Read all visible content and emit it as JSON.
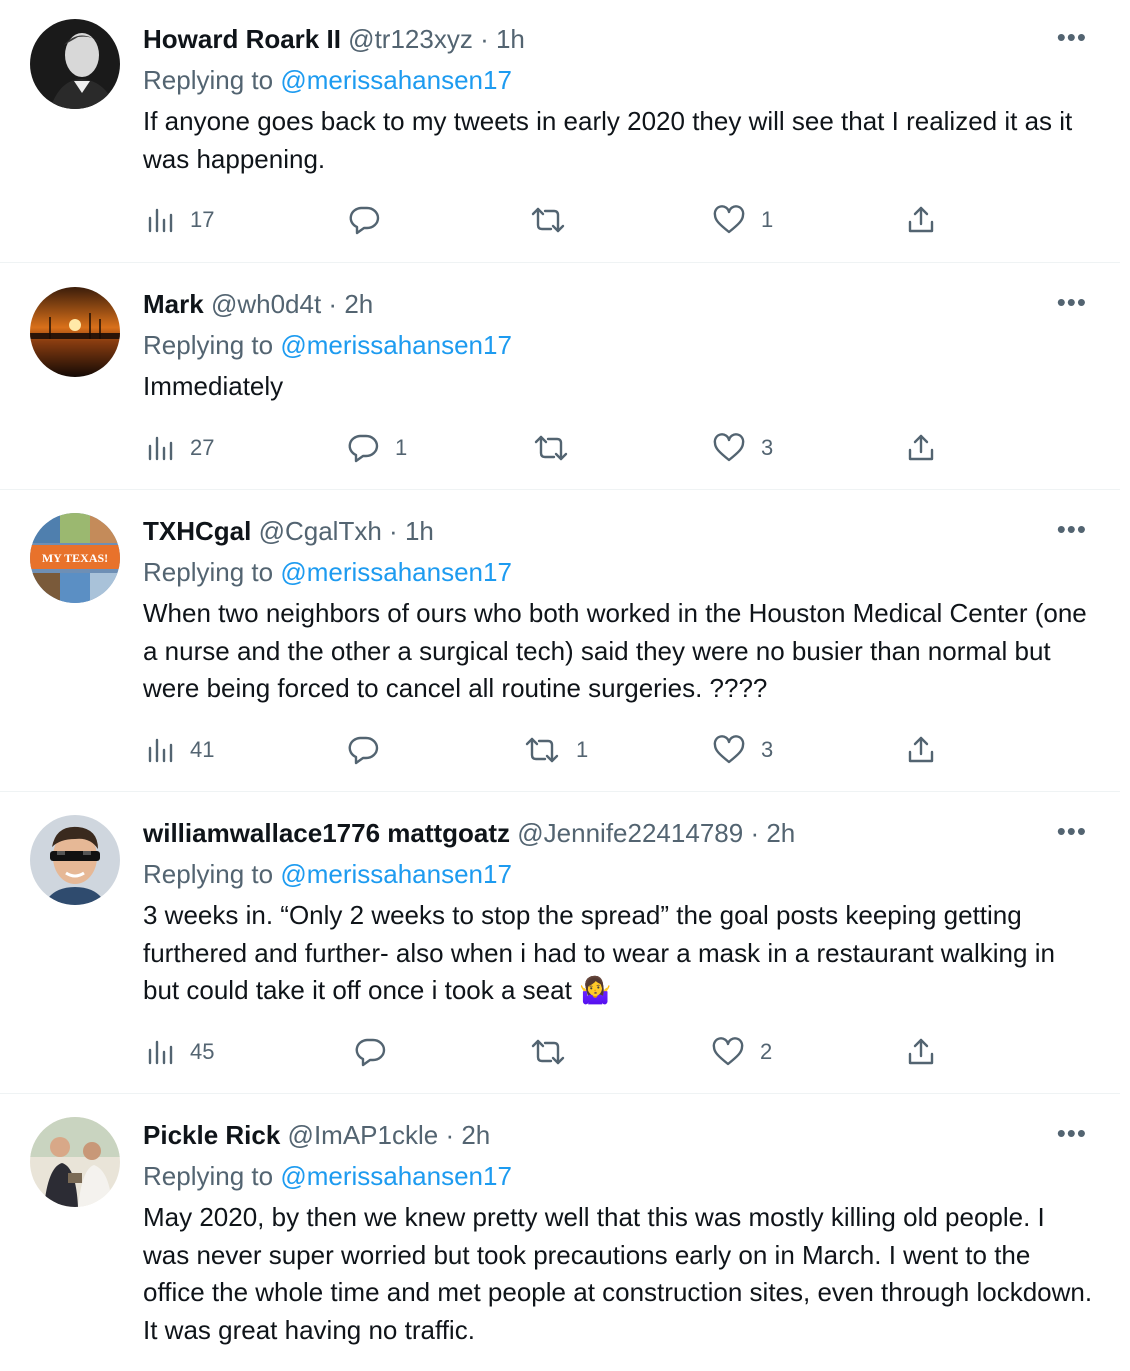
{
  "replying_label": "Replying to",
  "more_label": "•••",
  "tweets": [
    {
      "name": "Howard Roark II",
      "handle": "@tr123xyz",
      "separator": "·",
      "time": "1h",
      "mention": "@merissahansen17",
      "text": "If anyone goes back to my tweets in early 2020 they will see that I realized it as it was happening.",
      "views": "17",
      "replies": "",
      "retweets": "",
      "likes": "1"
    },
    {
      "name": "Mark",
      "handle": "@wh0d4t",
      "separator": "·",
      "time": "2h",
      "mention": "@merissahansen17",
      "text": "Immediately",
      "views": "27",
      "replies": "1",
      "retweets": "",
      "likes": "3"
    },
    {
      "name": "TXHCgal",
      "handle": "@CgalTxh",
      "separator": "·",
      "time": "1h",
      "mention": "@merissahansen17",
      "text": "When two neighbors of ours who both worked in the Houston Medical Center (one a nurse and the other a surgical tech) said they were no busier than normal but were being forced to cancel all routine surgeries.  ????",
      "avatar_text": "MY TEXAS!",
      "views": "41",
      "replies": "",
      "retweets": "1",
      "likes": "3"
    },
    {
      "name": "williamwallace1776 mattgoatz",
      "handle": "@Jennife22414789",
      "separator": "·",
      "time": "2h",
      "mention": "@merissahansen17",
      "text": "3 weeks in. “Only 2 weeks to stop the spread” the goal posts keeping getting furthered and further- also when i had to wear a mask in a restaurant walking in but could take it off once i took a seat 🤷‍♀️",
      "views": "45",
      "replies": "",
      "retweets": "",
      "likes": "2"
    },
    {
      "name": "Pickle Rick",
      "handle": "@ImAP1ckle",
      "separator": "·",
      "time": "2h",
      "mention": "@merissahansen17",
      "text": "May 2020, by then we knew pretty well that this was mostly killing old people. I was never super worried but took precautions early on in March. I went to the office the whole time and met people at construction sites, even through lockdown. It was great having no traffic."
    }
  ],
  "icons": {
    "views": "bar-chart-icon",
    "reply": "speech-bubble-icon",
    "retweet": "retweet-arrows-icon",
    "like": "heart-icon",
    "share": "share-upload-icon"
  },
  "colors": {
    "text": "#0f1419",
    "muted": "#536471",
    "mention": "#1d9bf0",
    "divider": "#eff3f4"
  }
}
